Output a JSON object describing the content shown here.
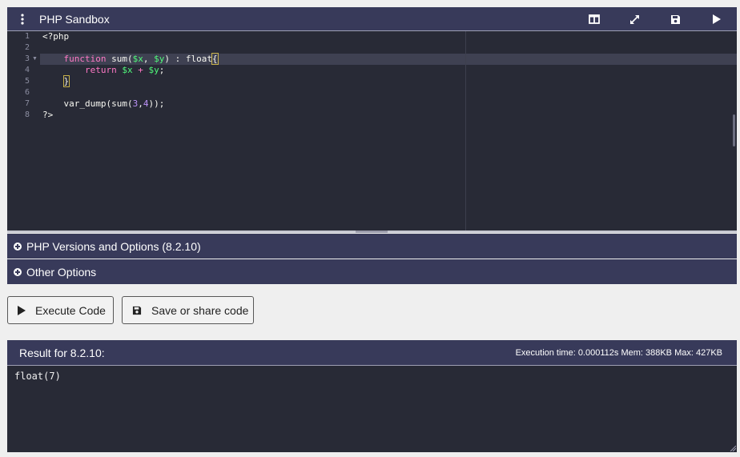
{
  "header": {
    "title": "PHP Sandbox",
    "icons": [
      "more-vertical-icon",
      "split-view-icon",
      "expand-icon",
      "save-icon",
      "play-icon"
    ]
  },
  "editor": {
    "line_numbers": [
      "1",
      "2",
      "3",
      "4",
      "5",
      "6",
      "7",
      "8"
    ],
    "lines": {
      "l1": "<?php",
      "l3_kw": "function",
      "l3_name": " sum(",
      "l3_x": "$x",
      "l3_comma": ", ",
      "l3_y": "$y",
      "l3_rest": ") : float",
      "l3_brace": "{",
      "l4_kw": "return",
      "l4_x": "$x",
      "l4_plus": " + ",
      "l4_y": "$y",
      "l4_semi": ";",
      "l5_brace": "}",
      "l7_fn": "var_dump(sum(",
      "l7_n1": "3",
      "l7_comma": ",",
      "l7_n2": "4",
      "l7_end": "));",
      "l8": "?>"
    },
    "colors": {
      "background": "#282a36",
      "keyword": "#ff79c6",
      "variable": "#50fa7b",
      "number": "#bd93f9"
    }
  },
  "sections": {
    "versions_label": "PHP Versions and Options (8.2.10)",
    "other_label": "Other Options"
  },
  "actions": {
    "execute_label": "Execute Code",
    "save_label": "Save or share code"
  },
  "result": {
    "title": "Result for 8.2.10:",
    "stats": "Execution time: 0.000112s Mem: 388KB Max: 427KB",
    "output": "float(7)"
  },
  "theme": {
    "header_bg": "#383a5a",
    "page_bg": "#efefef"
  }
}
